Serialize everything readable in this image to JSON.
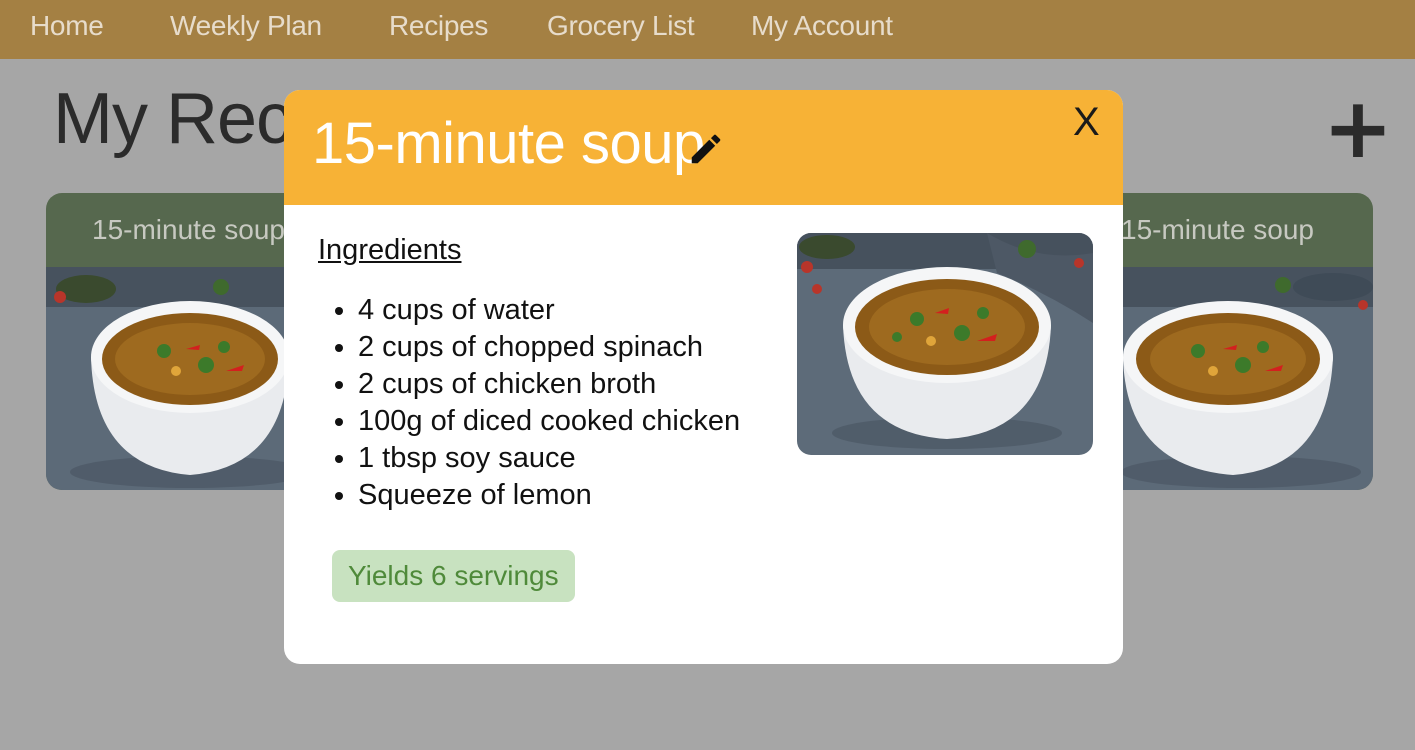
{
  "nav": {
    "items": [
      "Home",
      "Weekly Plan",
      "Recipes",
      "Grocery List",
      "My Account"
    ]
  },
  "page": {
    "title": "My Recipes",
    "add_label": "+"
  },
  "cards": [
    {
      "title": "15-minute soup",
      "image_icon": "soup-bowl-image"
    },
    {
      "title": "15-minute soup",
      "image_icon": "soup-bowl-image"
    }
  ],
  "modal": {
    "title": "15-minute soup",
    "edit_icon": "pencil-icon",
    "close_label": "X",
    "ingredients_heading": "Ingredients",
    "ingredients": [
      "4 cups of water",
      "2 cups of chopped spinach",
      "2 cups of chicken broth",
      "100g of diced cooked chicken",
      "1 tbsp soy sauce",
      "Squeeze of lemon"
    ],
    "yield": "Yields 6 servings"
  },
  "colors": {
    "nav_bg": "#a48043",
    "overlay_bg": "#a6a6a6",
    "modal_header": "#f7b236",
    "card_header": "#56684e",
    "yield_bg": "#c8e2c0",
    "yield_text": "#4f8a3a"
  }
}
